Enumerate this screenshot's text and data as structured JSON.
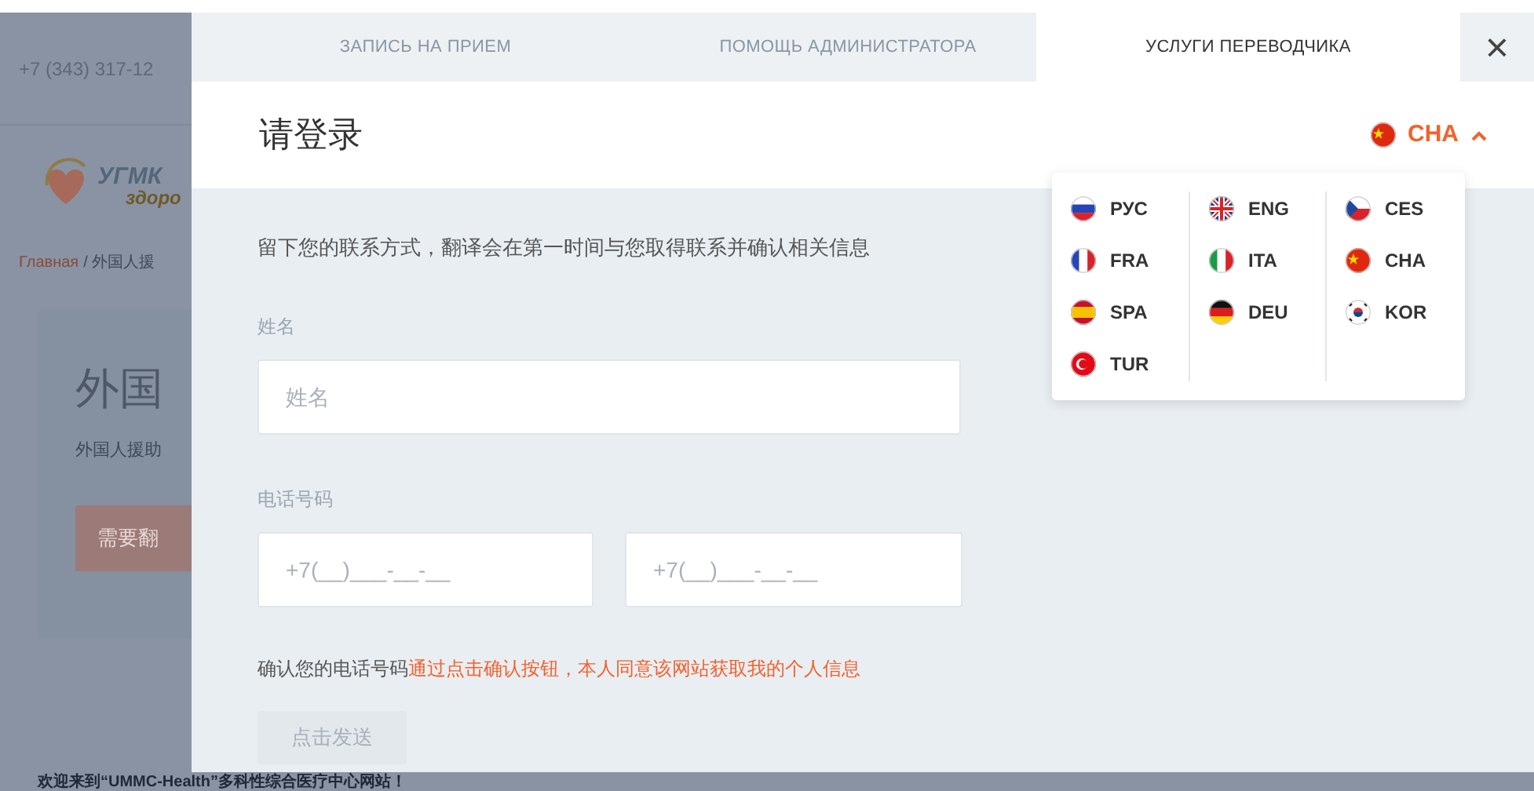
{
  "background_page": {
    "phone": "+7 (343) 317-12",
    "logo_top": "УГМК",
    "logo_bottom": "здоро",
    "breadcrumb_home": "Главная",
    "breadcrumb_rest": "/ 外国人援",
    "card_title": "外国",
    "card_subtitle": "外国人援助",
    "card_button": "需要翻",
    "welcome": "欢迎来到“UMMC-Health”多科性综合医疗中心网站！"
  },
  "tabs": [
    {
      "label": "ЗАПИСЬ НА ПРИЕМ",
      "selected": false
    },
    {
      "label": "ПОМОЩЬ АДМИНИСТРАТОРА",
      "selected": false
    },
    {
      "label": "УСЛУГИ ПЕРЕВОДЧИКА",
      "selected": true
    }
  ],
  "close": "×",
  "title": "请登录",
  "language": {
    "current": "CHA",
    "expanded": true,
    "columns": [
      [
        {
          "label": "РУС"
        },
        {
          "label": "FRA"
        },
        {
          "label": "SPA"
        },
        {
          "label": "TUR"
        }
      ],
      [
        {
          "label": "ENG"
        },
        {
          "label": "ITA"
        },
        {
          "label": "DEU"
        }
      ],
      [
        {
          "label": "CES"
        },
        {
          "label": "CHA"
        },
        {
          "label": "KOR"
        }
      ]
    ]
  },
  "intro": "留下您的联系方式，翻译会在第一时间与您取得联系并确认相关信息",
  "name_field": {
    "label": "姓名",
    "placeholder": "姓名"
  },
  "phone_field": {
    "label": "电话号码",
    "placeholders": [
      "+7(__)___-__-__",
      "+7(__)___-__-__"
    ]
  },
  "consent": {
    "text": "确认您的电话号码",
    "link": "通过点击确认按钮，本人同意该网站获取我的个人信息"
  },
  "submit": {
    "label": "点击发送",
    "disabled": true
  }
}
